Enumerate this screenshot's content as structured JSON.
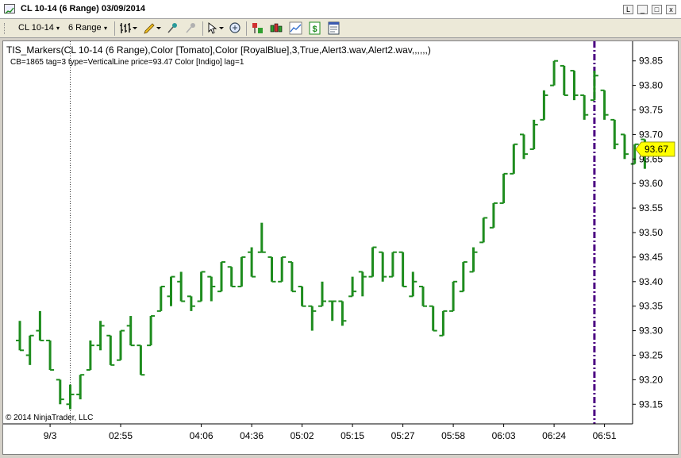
{
  "window": {
    "title": "CL 10-14 (6 Range)  03/09/2014",
    "min": "_",
    "max": "□",
    "close": "x",
    "restore": "L"
  },
  "toolbar": {
    "instrument": "CL 10-14",
    "period": "6 Range",
    "dropdown_glyph": "▾"
  },
  "indicator": {
    "line1": "TIS_Markers(CL 10-14 (6 Range),Color [Tomato],Color [RoyalBlue],3,True,Alert3.wav,Alert2.wav,,,,,,)",
    "line2": "CB=1865 tag=3 type=VerticalLine price=93.47 Color [Indigo] lag=1"
  },
  "copyright": "© 2014 NinjaTrader, LLC",
  "price_marker": "93.67",
  "colors": {
    "bar": "#1e8c1e",
    "marker_line": "#4b0082",
    "price_badge": "#ffff00"
  },
  "chart_data": {
    "type": "ohlc",
    "y_ticks": [
      "93.85",
      "93.80",
      "93.75",
      "93.70",
      "93.65",
      "93.60",
      "93.55",
      "93.50",
      "93.45",
      "93.40",
      "93.35",
      "93.30",
      "93.25",
      "93.20",
      "93.15"
    ],
    "ylim": [
      93.11,
      93.89
    ],
    "x_ticks": [
      "9/3",
      "02:55",
      "04:06",
      "04:36",
      "05:02",
      "05:15",
      "05:27",
      "05:58",
      "06:03",
      "06:24",
      "06:51"
    ],
    "x_tick_bar_index": [
      3,
      10,
      18,
      23,
      28,
      33,
      38,
      43,
      48,
      53,
      58
    ],
    "vertical_markers": [
      {
        "bar_index": 5,
        "style": "dotted",
        "color": "#333333"
      },
      {
        "bar_index": 57,
        "style": "dashdot",
        "color": "#4b0082",
        "price": 93.47
      }
    ],
    "bars": [
      {
        "o": 93.28,
        "h": 93.32,
        "l": 93.26,
        "c": 93.26
      },
      {
        "o": 93.25,
        "h": 93.29,
        "l": 93.23,
        "c": 93.29
      },
      {
        "o": 93.3,
        "h": 93.34,
        "l": 93.28,
        "c": 93.28
      },
      {
        "o": 93.28,
        "h": 93.28,
        "l": 93.22,
        "c": 93.22
      },
      {
        "o": 93.2,
        "h": 93.2,
        "l": 93.15,
        "c": 93.16
      },
      {
        "o": 93.15,
        "h": 93.19,
        "l": 93.14,
        "c": 93.17
      },
      {
        "o": 93.17,
        "h": 93.21,
        "l": 93.16,
        "c": 93.21
      },
      {
        "o": 93.22,
        "h": 93.28,
        "l": 93.22,
        "c": 93.27
      },
      {
        "o": 93.27,
        "h": 93.32,
        "l": 93.26,
        "c": 93.31
      },
      {
        "o": 93.29,
        "h": 93.29,
        "l": 93.23,
        "c": 93.23
      },
      {
        "o": 93.24,
        "h": 93.3,
        "l": 93.24,
        "c": 93.3
      },
      {
        "o": 93.31,
        "h": 93.33,
        "l": 93.27,
        "c": 93.27
      },
      {
        "o": 93.27,
        "h": 93.27,
        "l": 93.21,
        "c": 93.21
      },
      {
        "o": 93.27,
        "h": 93.33,
        "l": 93.27,
        "c": 93.33
      },
      {
        "o": 93.34,
        "h": 93.39,
        "l": 93.34,
        "c": 93.39
      },
      {
        "o": 93.37,
        "h": 93.41,
        "l": 93.35,
        "c": 93.41
      },
      {
        "o": 93.4,
        "h": 93.42,
        "l": 93.36,
        "c": 93.36
      },
      {
        "o": 93.37,
        "h": 93.37,
        "l": 93.34,
        "c": 93.35
      },
      {
        "o": 93.36,
        "h": 93.42,
        "l": 93.36,
        "c": 93.42
      },
      {
        "o": 93.41,
        "h": 93.41,
        "l": 93.36,
        "c": 93.39
      },
      {
        "o": 93.38,
        "h": 93.44,
        "l": 93.38,
        "c": 93.44
      },
      {
        "o": 93.43,
        "h": 93.43,
        "l": 93.39,
        "c": 93.39
      },
      {
        "o": 93.39,
        "h": 93.45,
        "l": 93.39,
        "c": 93.45
      },
      {
        "o": 93.46,
        "h": 93.47,
        "l": 93.41,
        "c": 93.41
      },
      {
        "o": 93.46,
        "h": 93.52,
        "l": 93.46,
        "c": 93.46
      },
      {
        "o": 93.45,
        "h": 93.45,
        "l": 93.4,
        "c": 93.4
      },
      {
        "o": 93.4,
        "h": 93.45,
        "l": 93.4,
        "c": 93.45
      },
      {
        "o": 93.44,
        "h": 93.44,
        "l": 93.38,
        "c": 93.38
      },
      {
        "o": 93.39,
        "h": 93.39,
        "l": 93.35,
        "c": 93.35
      },
      {
        "o": 93.35,
        "h": 93.35,
        "l": 93.3,
        "c": 93.34
      },
      {
        "o": 93.35,
        "h": 93.4,
        "l": 93.35,
        "c": 93.36
      },
      {
        "o": 93.36,
        "h": 93.36,
        "l": 93.32,
        "c": 93.36
      },
      {
        "o": 93.36,
        "h": 93.36,
        "l": 93.31,
        "c": 93.32
      },
      {
        "o": 93.37,
        "h": 93.41,
        "l": 93.37,
        "c": 93.38
      },
      {
        "o": 93.42,
        "h": 93.42,
        "l": 93.37,
        "c": 93.41
      },
      {
        "o": 93.41,
        "h": 93.47,
        "l": 93.41,
        "c": 93.47
      },
      {
        "o": 93.46,
        "h": 93.46,
        "l": 93.4,
        "c": 93.41
      },
      {
        "o": 93.41,
        "h": 93.46,
        "l": 93.41,
        "c": 93.46
      },
      {
        "o": 93.46,
        "h": 93.46,
        "l": 93.39,
        "c": 93.39
      },
      {
        "o": 93.37,
        "h": 93.42,
        "l": 93.37,
        "c": 93.4
      },
      {
        "o": 93.39,
        "h": 93.39,
        "l": 93.35,
        "c": 93.35
      },
      {
        "o": 93.35,
        "h": 93.35,
        "l": 93.3,
        "c": 93.3
      },
      {
        "o": 93.29,
        "h": 93.34,
        "l": 93.29,
        "c": 93.34
      },
      {
        "o": 93.34,
        "h": 93.4,
        "l": 93.34,
        "c": 93.4
      },
      {
        "o": 93.38,
        "h": 93.44,
        "l": 93.38,
        "c": 93.44
      },
      {
        "o": 93.42,
        "h": 93.47,
        "l": 93.42,
        "c": 93.46
      },
      {
        "o": 93.48,
        "h": 93.53,
        "l": 93.48,
        "c": 93.53
      },
      {
        "o": 93.51,
        "h": 93.56,
        "l": 93.51,
        "c": 93.56
      },
      {
        "o": 93.56,
        "h": 93.62,
        "l": 93.56,
        "c": 93.62
      },
      {
        "o": 93.62,
        "h": 93.68,
        "l": 93.62,
        "c": 93.68
      },
      {
        "o": 93.7,
        "h": 93.7,
        "l": 93.65,
        "c": 93.66
      },
      {
        "o": 93.67,
        "h": 93.73,
        "l": 93.67,
        "c": 93.72
      },
      {
        "o": 93.73,
        "h": 93.79,
        "l": 93.73,
        "c": 93.78
      },
      {
        "o": 93.8,
        "h": 93.85,
        "l": 93.8,
        "c": 93.85
      },
      {
        "o": 93.84,
        "h": 93.84,
        "l": 93.78,
        "c": 93.78
      },
      {
        "o": 93.83,
        "h": 93.83,
        "l": 93.77,
        "c": 93.78
      },
      {
        "o": 93.78,
        "h": 93.78,
        "l": 93.73,
        "c": 93.74
      },
      {
        "o": 93.77,
        "h": 93.83,
        "l": 93.77,
        "c": 93.82
      },
      {
        "o": 93.79,
        "h": 93.79,
        "l": 93.73,
        "c": 93.74
      },
      {
        "o": 93.73,
        "h": 93.73,
        "l": 93.67,
        "c": 93.68
      },
      {
        "o": 93.7,
        "h": 93.7,
        "l": 93.65,
        "c": 93.66
      },
      {
        "o": 93.64,
        "h": 93.68,
        "l": 93.64,
        "c": 93.68
      },
      {
        "o": 93.69,
        "h": 93.69,
        "l": 93.63,
        "c": 93.67
      }
    ]
  }
}
